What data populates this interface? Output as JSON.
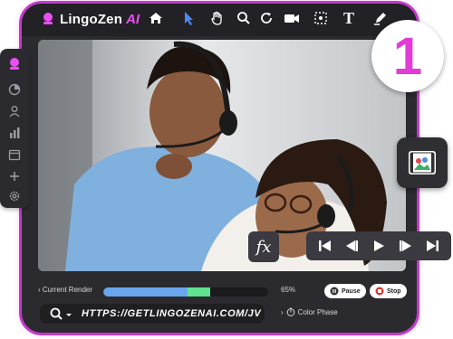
{
  "app": {
    "brand": "LingoZen",
    "brand_suffix": "AI"
  },
  "toolbar": {
    "tools": [
      "home-icon",
      "cursor-icon",
      "hand-icon",
      "zoom-icon",
      "refresh-icon",
      "camera-icon",
      "crop-icon",
      "text-icon",
      "pen-icon"
    ]
  },
  "sidebar": {
    "items": [
      "logo-mini-icon",
      "chart-pie-icon",
      "user-icon",
      "bar-chart-icon",
      "calendar-icon",
      "plus-icon",
      "settings-icon"
    ]
  },
  "badge": {
    "number": "1"
  },
  "render": {
    "label": "Current Render",
    "percent_text": "65%",
    "progress": 0.65,
    "pause_label": "Pause",
    "stop_label": "Stop"
  },
  "address": {
    "url": "HTTPS://GETLINGOZENAI.COM/JV"
  },
  "color_phase": {
    "label": "Color Phase"
  },
  "fx": {
    "label": "fx"
  },
  "colors": {
    "accent": "#c23ac9",
    "progress_blue": "#6aa6ee",
    "progress_green": "#5fe38f",
    "badge_text": "#e23bd8"
  }
}
